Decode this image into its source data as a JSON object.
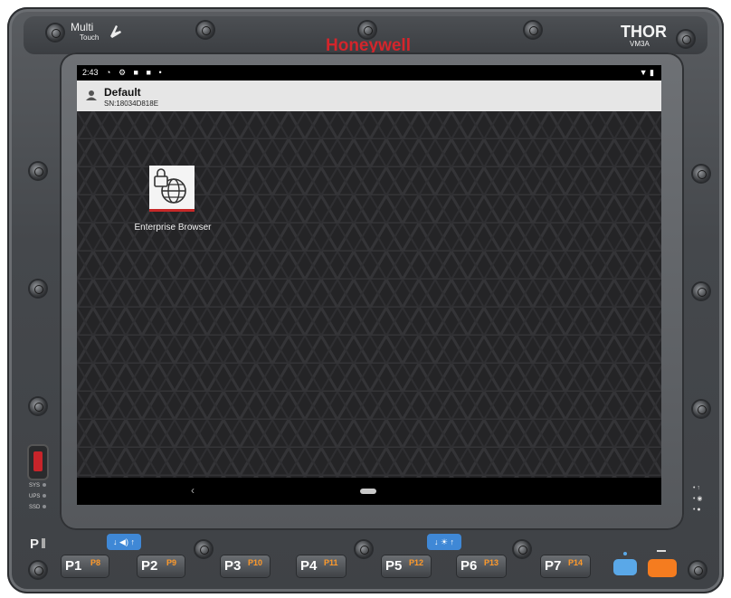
{
  "device": {
    "brand": "Honeywell",
    "multitouch": {
      "line1": "Multi",
      "line2": "Touch"
    },
    "model": "THOR",
    "model_sub": "VM3A",
    "indicator_left": "P"
  },
  "statusbar": {
    "time": "2:43"
  },
  "header": {
    "title": "Default",
    "serial": "SN:18034D818E"
  },
  "apps": [
    {
      "label": "Enterprise Browser",
      "icon": "lock-globe-icon"
    }
  ],
  "leds": [
    "SYS",
    "UPS",
    "SSD"
  ],
  "keys": [
    {
      "primary": "P1",
      "secondary": "P8"
    },
    {
      "primary": "P2",
      "secondary": "P9"
    },
    {
      "primary": "P3",
      "secondary": "P10"
    },
    {
      "primary": "P4",
      "secondary": "P11"
    },
    {
      "primary": "P5",
      "secondary": "P12"
    },
    {
      "primary": "P6",
      "secondary": "P13"
    },
    {
      "primary": "P7",
      "secondary": "P14"
    }
  ],
  "colors": {
    "brand_red": "#d4252b",
    "key_orange": "#ff9a2a",
    "key_blue": "#3f88d6",
    "right_blue": "#5aa8e8",
    "right_orange": "#f57c1f"
  }
}
